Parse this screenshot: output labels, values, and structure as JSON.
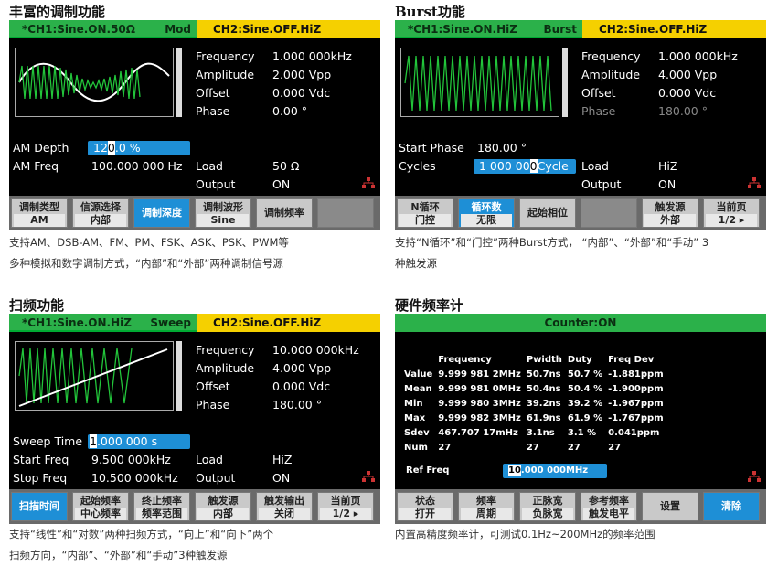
{
  "sections": {
    "mod": {
      "title": "丰富的调制功能",
      "header": {
        "ch1": "*CH1:Sine.ON.50Ω",
        "mode": "Mod",
        "ch2": "CH2:Sine.OFF.HiZ"
      },
      "params": [
        {
          "label": "Frequency",
          "value": "1.000 000kHz"
        },
        {
          "label": "Amplitude",
          "value": "2.000 Vpp"
        },
        {
          "label": "Offset",
          "value": "0.000 Vdc"
        },
        {
          "label": "Phase",
          "value": "0.00 °"
        }
      ],
      "am_depth": {
        "label": "AM Depth",
        "v1": "12",
        "v2": "0",
        "v3": ".0 %"
      },
      "am_freq": {
        "label": "AM Freq",
        "value": "100.000 000 Hz"
      },
      "load": {
        "label": "Load",
        "value": "50 Ω"
      },
      "output": {
        "label": "Output",
        "value": "ON"
      },
      "menu": [
        {
          "a": "调制类型",
          "b": "AM"
        },
        {
          "a": "信源选择",
          "b": "内部"
        },
        {
          "a": "调制深度",
          "b": ""
        },
        {
          "a": "调制波形",
          "b": "Sine"
        },
        {
          "a": "调制频率",
          "b": ""
        },
        {
          "a": "",
          "b": ""
        }
      ],
      "caption1": "支持AM、DSB-AM、FM、PM、FSK、ASK、PSK、PWM等",
      "caption2": "多种模拟和数字调制方式，“内部”和“外部”两种调制信号源"
    },
    "burst": {
      "title": "Burst功能",
      "header": {
        "ch1": "*CH1:Sine.ON.HiZ",
        "mode": "Burst",
        "ch2": "CH2:Sine.OFF.HiZ"
      },
      "params": [
        {
          "label": "Frequency",
          "value": "1.000 000kHz"
        },
        {
          "label": "Amplitude",
          "value": "4.000 Vpp"
        },
        {
          "label": "Offset",
          "value": "0.000 Vdc"
        },
        {
          "label": "Phase",
          "value": "180.00 °"
        }
      ],
      "start_phase": {
        "label": "Start Phase",
        "value": "180.00 °"
      },
      "cycles": {
        "label": "Cycles",
        "v1": "1 000 00",
        "v2": "0",
        "v3": "Cycle"
      },
      "load": {
        "label": "Load",
        "value": "HiZ"
      },
      "output": {
        "label": "Output",
        "value": "ON"
      },
      "menu": [
        {
          "a": "N循环",
          "b": "门控"
        },
        {
          "a": "循环数",
          "b": "无限"
        },
        {
          "a": "起始相位",
          "b": ""
        },
        {
          "a": "",
          "b": ""
        },
        {
          "a": "触发源",
          "b": "外部"
        },
        {
          "a": "当前页",
          "b": "1/2 ▸"
        }
      ],
      "caption1": "支持“N循环”和“门控”两种Burst方式， “内部”、“外部”和“手动” 3",
      "caption2": "种触发源"
    },
    "sweep": {
      "title": "扫频功能",
      "header": {
        "ch1": "*CH1:Sine.ON.HiZ",
        "mode": "Sweep",
        "ch2": "CH2:Sine.OFF.HiZ"
      },
      "params": [
        {
          "label": "Frequency",
          "value": "10.000 000kHz"
        },
        {
          "label": "Amplitude",
          "value": "4.000 Vpp"
        },
        {
          "label": "Offset",
          "value": "0.000 Vdc"
        },
        {
          "label": "Phase",
          "value": "180.00 °"
        }
      ],
      "sweep_time": {
        "label": "Sweep Time",
        "v1": "1",
        "v2": ".000 000 s"
      },
      "start_freq": {
        "label": "Start Freq",
        "value": "9.500 000kHz"
      },
      "stop_freq": {
        "label": "Stop Freq",
        "value": "10.500 000kHz"
      },
      "load": {
        "label": "Load",
        "value": "HiZ"
      },
      "output": {
        "label": "Output",
        "value": "ON"
      },
      "menu": [
        {
          "a": "扫描时间",
          "b": ""
        },
        {
          "a": "起始频率",
          "b": "中心频率"
        },
        {
          "a": "终止频率",
          "b": "频率范围"
        },
        {
          "a": "触发源",
          "b": "内部"
        },
        {
          "a": "触发输出",
          "b": "关闭"
        },
        {
          "a": "当前页",
          "b": "1/2 ▸"
        }
      ],
      "caption1": "支持“线性”和“对数”两种扫频方式，“向上”和“向下”两个",
      "caption2": "扫频方向，“内部”、“外部”和“手动”3种触发源"
    },
    "counter": {
      "title": "硬件频率计",
      "header": "Counter:ON",
      "cols": [
        "",
        "Frequency",
        "Pwidth",
        "Duty",
        "Freq Dev"
      ],
      "rows": [
        [
          "Value",
          "9.999 981 2MHz",
          "50.7ns",
          "50.7 %",
          "-1.881ppm"
        ],
        [
          "Mean",
          "9.999 981 0MHz",
          "50.4ns",
          "50.4 %",
          "-1.900ppm"
        ],
        [
          "Min",
          "9.999 980 3MHz",
          "39.2ns",
          "39.2 %",
          "-1.967ppm"
        ],
        [
          "Max",
          "9.999 982 3MHz",
          "61.9ns",
          "61.9 %",
          "-1.767ppm"
        ],
        [
          "Sdev",
          "467.707 17mHz",
          "3.1ns",
          "3.1 %",
          "0.041ppm"
        ],
        [
          "Num",
          "27",
          "27",
          "27",
          "27"
        ]
      ],
      "ref_freq": {
        "label": "Ref Freq",
        "v1": "10",
        "v2": ".000 000MHz"
      },
      "menu": [
        {
          "a": "状态",
          "b": "打开"
        },
        {
          "a": "频率",
          "b": "周期"
        },
        {
          "a": "正脉宽",
          "b": "负脉宽"
        },
        {
          "a": "参考频率",
          "b": "触发电平"
        },
        {
          "a": "设置",
          "b": ""
        },
        {
          "a": "清除",
          "b": ""
        }
      ],
      "caption1": "内置高精度频率计，可测试0.1Hz~200MHz的频率范围"
    }
  },
  "colors": {
    "ch1_green": "#2bb14a",
    "ch2_yellow": "#f5d000",
    "highlight_blue": "#1e8fd6",
    "wave_green": "#22c43a"
  }
}
